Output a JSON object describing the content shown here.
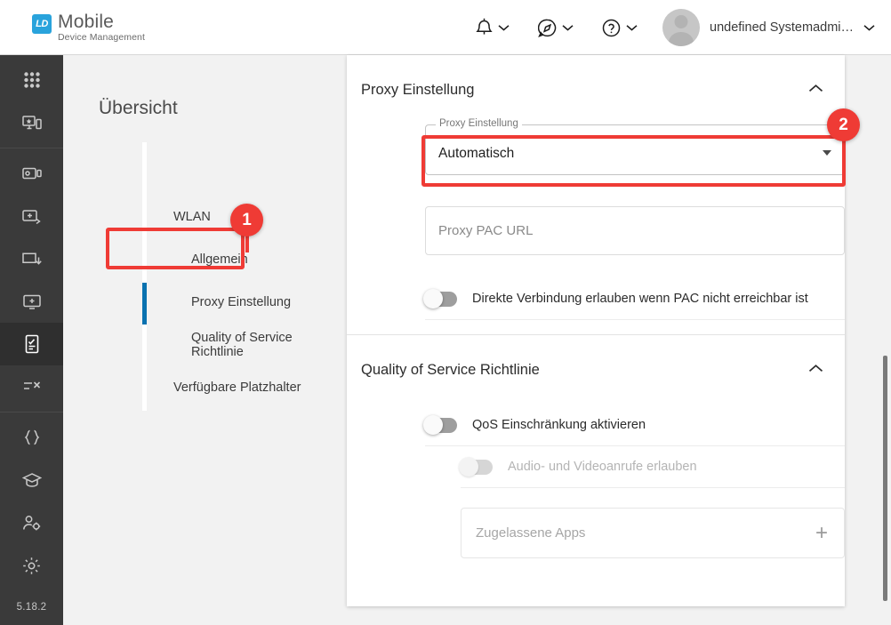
{
  "header": {
    "brand_mark": "LD",
    "brand_title": "Mobile",
    "brand_subtitle": "Device Management",
    "user_name": "undefined Systemadmi…",
    "icons": [
      {
        "name": "notifications-bell-icon",
        "label": "bell-icon"
      },
      {
        "name": "feedback-compass-icon",
        "label": "compass-icon"
      },
      {
        "name": "help-question-icon",
        "label": "help-icon"
      }
    ]
  },
  "rail": {
    "version": "5.18.2",
    "items": [
      {
        "name": "apps-grid-icon",
        "label": "Apps"
      },
      {
        "name": "device-enrollment-icon",
        "label": "Enrollment"
      },
      {
        "name": "devices-icon",
        "label": "Devices"
      },
      {
        "name": "add-device-icon",
        "label": "Add device"
      },
      {
        "name": "download-icon",
        "label": "Downloads"
      },
      {
        "name": "add-screen-icon",
        "label": "Add screen"
      },
      {
        "name": "policy-document-icon",
        "label": "Policies",
        "active": true
      },
      {
        "name": "tasks-list-icon",
        "label": "Tasks"
      },
      {
        "name": "code-braces-icon",
        "label": "Code"
      },
      {
        "name": "graduation-cap-icon",
        "label": "Learning"
      },
      {
        "name": "user-settings-icon",
        "label": "Users"
      },
      {
        "name": "gear-icon",
        "label": "Settings"
      }
    ]
  },
  "nav": {
    "title": "Übersicht",
    "items": [
      {
        "label": "WLAN",
        "level": 1,
        "active": false
      },
      {
        "label": "Allgemein",
        "level": 2,
        "active": false
      },
      {
        "label": "Proxy Einstellung",
        "level": 2,
        "active": true
      },
      {
        "label": "Quality of Service Richtlinie",
        "level": 2,
        "active": false
      },
      {
        "label": "Verfügbare Platzhalter",
        "level": 1,
        "active": false
      }
    ]
  },
  "main": {
    "sections": [
      {
        "title": "Proxy Einstellung",
        "expanded": true,
        "select_label": "Proxy Einstellung",
        "select_value": "Automatisch",
        "pac_url_placeholder": "Proxy PAC URL",
        "pac_url_value": "",
        "direct_toggle_label": "Direkte Verbindung erlauben wenn PAC nicht erreichbar ist",
        "direct_toggle_on": false
      },
      {
        "title": "Quality of Service Richtlinie",
        "expanded": true,
        "qos_toggle_label": "QoS Einschränkung aktivieren",
        "qos_toggle_on": false,
        "av_toggle_label": "Audio- und Videoanrufe erlauben",
        "av_toggle_on": false,
        "av_toggle_disabled": true,
        "apps_placeholder": "Zugelassene Apps",
        "apps_add_icon": "plus-icon"
      }
    ]
  },
  "annotations": [
    {
      "number": "1",
      "target": "nav-item-proxy-einstellung"
    },
    {
      "number": "2",
      "target": "proxy-setting-select"
    }
  ],
  "colors": {
    "accent_blue": "#0a72b0",
    "annotation_red": "#ef3b35",
    "rail_dark": "#3a3a3a",
    "page_gray": "#f2f2f2",
    "brand_blue": "#29a3dc"
  }
}
